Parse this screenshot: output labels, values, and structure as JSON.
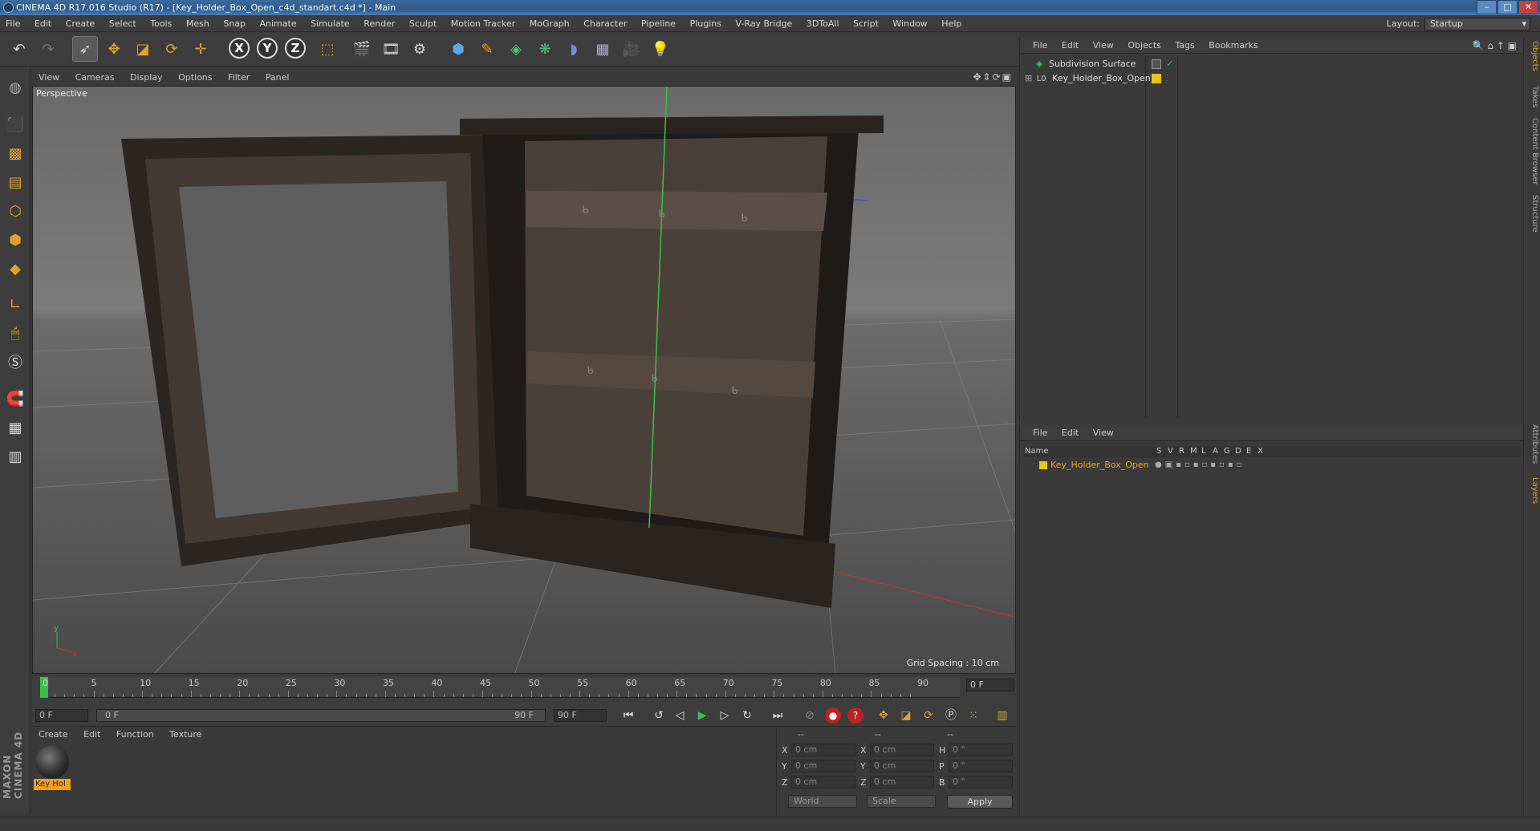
{
  "window": {
    "title": "CINEMA 4D R17.016 Studio (R17) - [Key_Holder_Box_Open_c4d_standart.c4d *] - Main",
    "min_label": "–",
    "max_label": "□",
    "close_label": "✕"
  },
  "menubar": {
    "items": [
      "File",
      "Edit",
      "Create",
      "Select",
      "Tools",
      "Mesh",
      "Snap",
      "Animate",
      "Simulate",
      "Render",
      "Sculpt",
      "Motion Tracker",
      "MoGraph",
      "Character",
      "Pipeline",
      "Plugins",
      "V-Ray Bridge",
      "3DToAll",
      "Script",
      "Window",
      "Help"
    ],
    "layout_label": "Layout:",
    "layout_value": "Startup"
  },
  "toolbar": {
    "axis_x": "X",
    "axis_y": "Y",
    "axis_z": "Z"
  },
  "viewport": {
    "menu": [
      "View",
      "Cameras",
      "Display",
      "Options",
      "Filter",
      "Panel"
    ],
    "label": "Perspective",
    "grid_spacing": "Grid Spacing : 10 cm",
    "axis_y": "y",
    "axis_x": "x"
  },
  "timeline": {
    "ticks": [
      "0",
      "5",
      "10",
      "15",
      "20",
      "25",
      "30",
      "35",
      "40",
      "45",
      "50",
      "55",
      "60",
      "65",
      "70",
      "75",
      "80",
      "85",
      "90"
    ],
    "current_frame": "0 F"
  },
  "transport": {
    "start_field": "0 F",
    "range_start": "0 F",
    "range_end": "90 F",
    "end_field": "90 F"
  },
  "material_manager": {
    "menu": [
      "Create",
      "Edit",
      "Function",
      "Texture"
    ],
    "materials": [
      {
        "name": "Key Hol"
      }
    ]
  },
  "coordinates": {
    "header_dashes": [
      "--",
      "--",
      "--"
    ],
    "rows": [
      {
        "a_label": "X",
        "a_value": "0 cm",
        "b_label": "X",
        "b_value": "0 cm",
        "c_label": "H",
        "c_value": "0 °"
      },
      {
        "a_label": "Y",
        "a_value": "0 cm",
        "b_label": "Y",
        "b_value": "0 cm",
        "c_label": "P",
        "c_value": "0 °"
      },
      {
        "a_label": "Z",
        "a_value": "0 cm",
        "b_label": "Z",
        "b_value": "0 cm",
        "c_label": "B",
        "c_value": "0 °"
      }
    ],
    "world_select": "World",
    "scale_select": "Scale",
    "apply_label": "Apply"
  },
  "object_manager": {
    "menu": [
      "File",
      "Edit",
      "View",
      "Objects",
      "Tags",
      "Bookmarks"
    ],
    "objects": [
      {
        "name": "Subdivision Surface",
        "check": "✓"
      },
      {
        "name": "Key_Holder_Box_Open",
        "expander": "⊞",
        "layer_label": "L0"
      }
    ]
  },
  "layer_manager": {
    "menu": [
      "File",
      "Edit",
      "View"
    ],
    "columns": {
      "name": "Name",
      "s": "S",
      "v": "V",
      "r": "R",
      "m": "M",
      "l": "L",
      "a": "A",
      "g": "G",
      "d": "D",
      "e": "E",
      "x": "X"
    },
    "layers": [
      {
        "name": "Key_Holder_Box_Open"
      }
    ]
  },
  "right_tabs": [
    "Objects",
    "Takes",
    "Content Browser",
    "Structure",
    "Attributes",
    "Layers"
  ],
  "branding": {
    "logo_text": "MAXON CINEMA 4D"
  },
  "colors": {
    "accent": "#e0a030",
    "layer_yellow": "#e8c61a",
    "selected_text": "#f0a020",
    "timeline_marker": "#3cc04a",
    "y_axis": "#3cc04a",
    "x_axis": "#cc3030"
  }
}
